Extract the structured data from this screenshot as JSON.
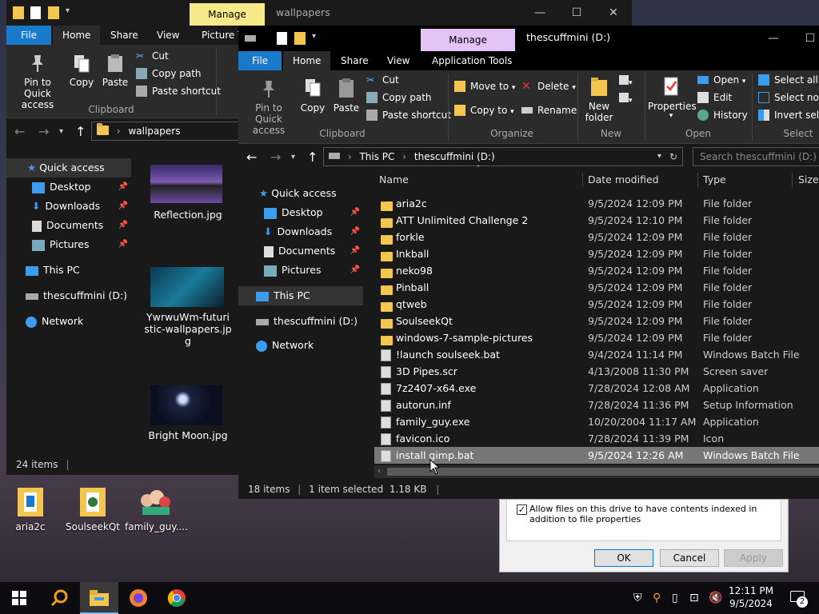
{
  "desktop": {
    "icons": [
      {
        "label": "aria2c"
      },
      {
        "label": "SoulseekQt"
      },
      {
        "label": "family_guy...."
      }
    ]
  },
  "back_window": {
    "title": "wallpapers",
    "manage_tab": "Manage",
    "tabs": [
      "File",
      "Home",
      "Share",
      "View",
      "Picture To"
    ],
    "clipboard": {
      "pin": "Pin to Quick access",
      "copy": "Copy",
      "paste": "Paste",
      "cut": "Cut",
      "copy_path": "Copy path",
      "paste_shortcut": "Paste shortcut",
      "group": "Clipboard"
    },
    "address": "wallpapers",
    "nav": {
      "quick_access": "Quick access",
      "desktop": "Desktop",
      "downloads": "Downloads",
      "documents": "Documents",
      "pictures": "Pictures",
      "this_pc": "This PC",
      "drive": "thescuffmini (D:)",
      "network": "Network"
    },
    "thumbs": [
      {
        "label": "Reflection.jpg"
      },
      {
        "label": "YwrwuWm-futuristic-wallpapers.jpg",
        "display": [
          "YwrwuWm-futuri",
          "stic-wallpapers.jp",
          "g"
        ]
      },
      {
        "label": "Bright Moon.jpg"
      }
    ],
    "status": "24 items"
  },
  "front_window": {
    "title": "thescuffmini (D:)",
    "manage_tab": "Manage",
    "tabs": [
      "File",
      "Home",
      "Share",
      "View",
      "Application Tools"
    ],
    "ribbon": {
      "pin": "Pin to Quick access",
      "copy": "Copy",
      "paste": "Paste",
      "cut": "Cut",
      "copy_path": "Copy path",
      "paste_shortcut": "Paste shortcut",
      "move_to": "Move to",
      "copy_to": "Copy to",
      "delete": "Delete",
      "rename": "Rename",
      "new_folder": "New folder",
      "properties": "Properties",
      "open": "Open",
      "edit": "Edit",
      "history": "History",
      "select_all": "Select all",
      "select_none": "Select none",
      "invert_selection": "Invert selec",
      "groups": {
        "clipboard": "Clipboard",
        "organize": "Organize",
        "new": "New",
        "open": "Open",
        "select": "Select"
      }
    },
    "address": {
      "root": "This PC",
      "current": "thescuffmini (D:)"
    },
    "search_placeholder": "Search thescuffmini (D:)",
    "nav": {
      "quick_access": "Quick access",
      "desktop": "Desktop",
      "downloads": "Downloads",
      "documents": "Documents",
      "pictures": "Pictures",
      "this_pc": "This PC",
      "drive": "thescuffmini (D:)",
      "network": "Network"
    },
    "columns": {
      "name": "Name",
      "date": "Date modified",
      "type": "Type",
      "size": "Size"
    },
    "files": [
      {
        "name": "aria2c",
        "date": "9/5/2024 12:09 PM",
        "type": "File folder",
        "icon": "folder"
      },
      {
        "name": "ATT Unlimited Challenge 2",
        "date": "9/5/2024 12:10 PM",
        "type": "File folder",
        "icon": "folder"
      },
      {
        "name": "forkle",
        "date": "9/5/2024 12:09 PM",
        "type": "File folder",
        "icon": "folder"
      },
      {
        "name": "Inkball",
        "date": "9/5/2024 12:09 PM",
        "type": "File folder",
        "icon": "folder"
      },
      {
        "name": "neko98",
        "date": "9/5/2024 12:09 PM",
        "type": "File folder",
        "icon": "folder"
      },
      {
        "name": "Pinball",
        "date": "9/5/2024 12:09 PM",
        "type": "File folder",
        "icon": "folder"
      },
      {
        "name": "qtweb",
        "date": "9/5/2024 12:09 PM",
        "type": "File folder",
        "icon": "folder"
      },
      {
        "name": "SoulseekQt",
        "date": "9/5/2024 12:09 PM",
        "type": "File folder",
        "icon": "folder"
      },
      {
        "name": "windows-7-sample-pictures",
        "date": "9/5/2024 12:09 PM",
        "type": "File folder",
        "icon": "folder"
      },
      {
        "name": "!launch soulseek.bat",
        "date": "9/4/2024 11:14 PM",
        "type": "Windows Batch File",
        "icon": "file"
      },
      {
        "name": "3D Pipes.scr",
        "date": "4/13/2008 11:30 PM",
        "type": "Screen saver",
        "icon": "file"
      },
      {
        "name": "7z2407-x64.exe",
        "date": "7/28/2024 12:08 AM",
        "type": "Application",
        "icon": "file"
      },
      {
        "name": "autorun.inf",
        "date": "7/28/2024 11:36 PM",
        "type": "Setup Information",
        "icon": "file"
      },
      {
        "name": "family_guy.exe",
        "date": "10/20/2004 11:17 AM",
        "type": "Application",
        "icon": "file"
      },
      {
        "name": "favicon.ico",
        "date": "7/28/2024 11:39 PM",
        "type": "Icon",
        "icon": "file"
      },
      {
        "name": "install gimp.bat",
        "date": "9/5/2024 12:26 AM",
        "type": "Windows Batch File",
        "icon": "file",
        "selected": true
      }
    ],
    "status": {
      "items": "18 items",
      "selected": "1 item selected  1.18 KB"
    }
  },
  "dialog": {
    "checkbox_label": "Allow files on this drive to have contents indexed in addition to file properties",
    "ok": "OK",
    "cancel": "Cancel",
    "apply": "Apply"
  },
  "taskbar": {
    "time": "12:11 PM",
    "date": "9/5/2024",
    "notification_count": "2"
  }
}
